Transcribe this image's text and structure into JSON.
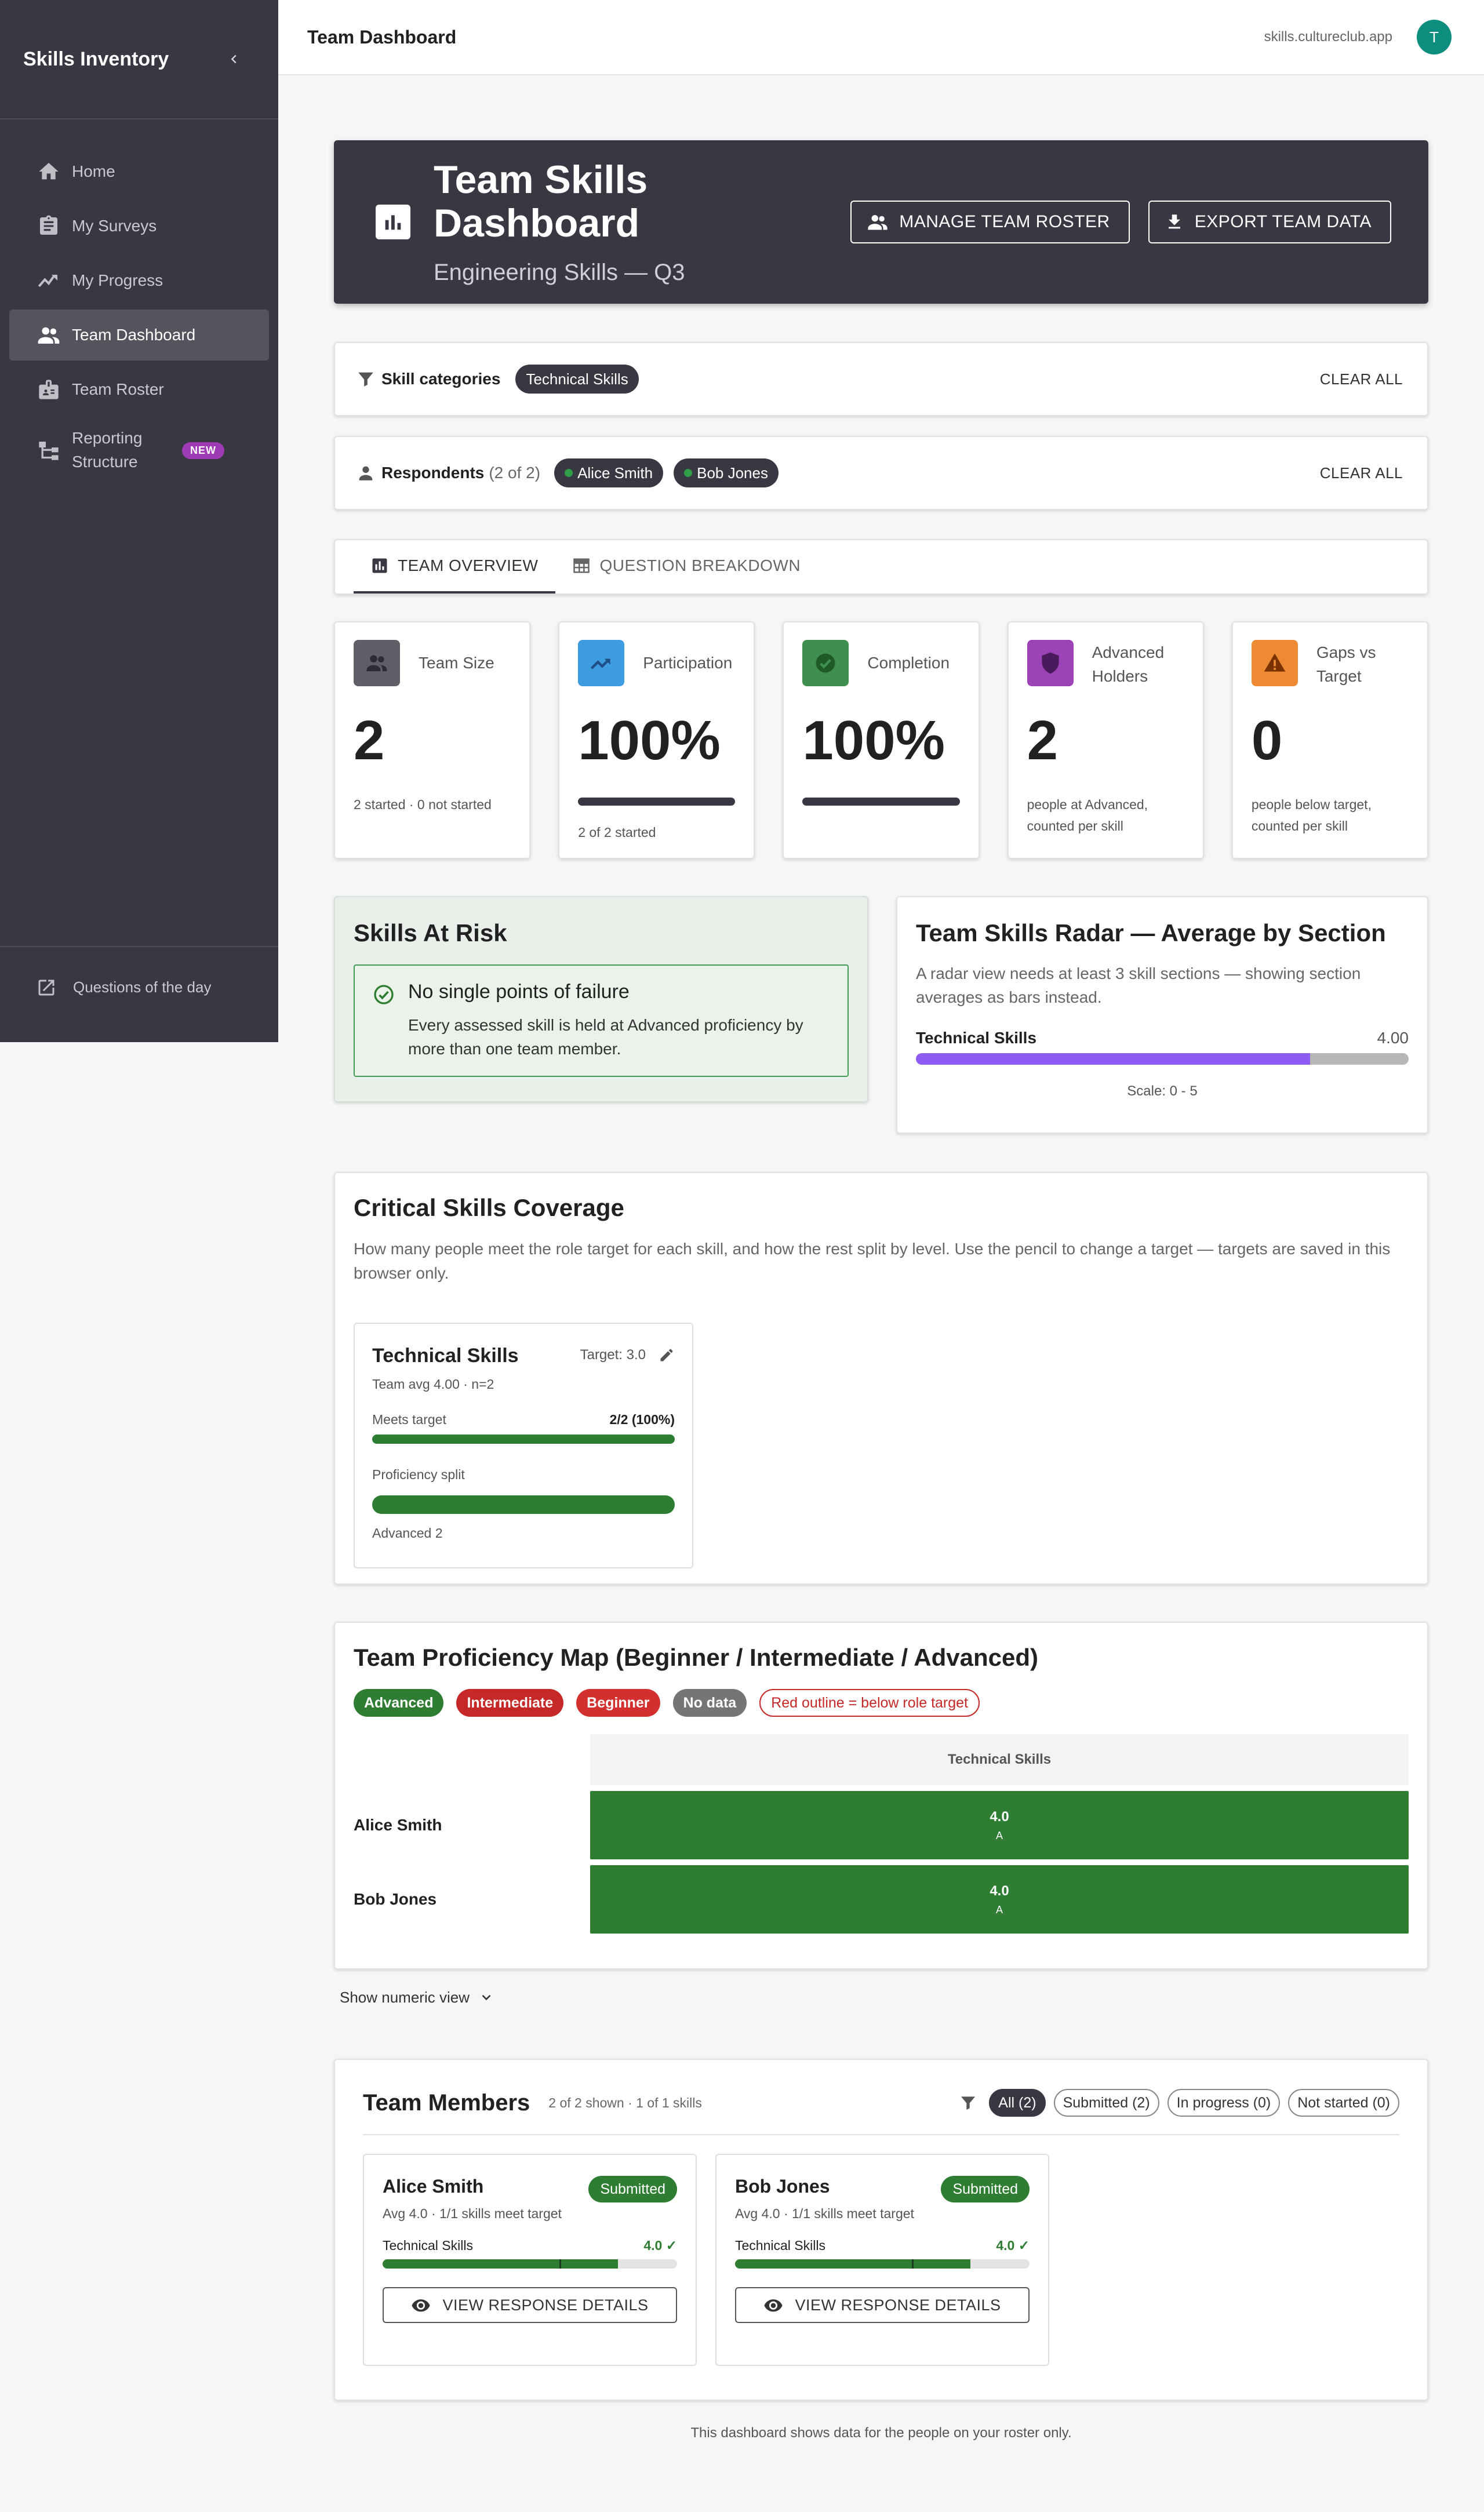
{
  "sidebar": {
    "title": "Skills Inventory",
    "items": [
      {
        "label": "Home",
        "icon": "home-icon"
      },
      {
        "label": "My Surveys",
        "icon": "clipboard-icon"
      },
      {
        "label": "My Progress",
        "icon": "trend-icon"
      },
      {
        "label": "Team Dashboard",
        "icon": "people-icon",
        "active": true
      },
      {
        "label": "Team Roster",
        "icon": "badge-icon"
      },
      {
        "label": "Reporting Structure",
        "icon": "org-chart-icon",
        "badge": "NEW"
      }
    ],
    "footer_label": "Questions of the day"
  },
  "topbar": {
    "title": "Team Dashboard",
    "domain": "skills.cultureclub.app",
    "avatar_initial": "T"
  },
  "hero": {
    "title": "Team Skills Dashboard",
    "subtitle": "Engineering Skills — Q3",
    "manage_btn": "MANAGE TEAM ROSTER",
    "export_btn": "EXPORT TEAM DATA"
  },
  "filters": {
    "categories": {
      "label": "Skill categories",
      "chips": [
        "Technical Skills"
      ],
      "clear": "CLEAR ALL"
    },
    "respondents": {
      "label": "Respondents",
      "count": "(2 of 2)",
      "chips": [
        "Alice Smith",
        "Bob Jones"
      ],
      "clear": "CLEAR ALL"
    }
  },
  "tabs": [
    {
      "label": "TEAM OVERVIEW",
      "active": true
    },
    {
      "label": "QUESTION BREAKDOWN",
      "active": false
    }
  ],
  "kpis": [
    {
      "label": "Team Size",
      "value": "2",
      "note": "2 started · 0 not started",
      "icon": "people-icon",
      "color": "#5f5f68"
    },
    {
      "label": "Participation",
      "value": "100%",
      "note": "2 of 2 started",
      "icon": "trend-icon",
      "color": "#3e9de0",
      "progress": 1.0
    },
    {
      "label": "Completion",
      "value": "100%",
      "note": "",
      "icon": "check-circle-icon",
      "color": "#3f8f4e",
      "progress": 1.0
    },
    {
      "label": "Advanced Holders",
      "value": "2",
      "note": "people at Advanced, counted per skill",
      "icon": "shield-icon",
      "color": "#9b44b8"
    },
    {
      "label": "Gaps vs Target",
      "value": "0",
      "note": "people below target, counted per skill",
      "icon": "warning-icon",
      "color": "#ee8a34"
    }
  ],
  "risk": {
    "title": "Skills At Risk",
    "heading": "No single points of failure",
    "text": "Every assessed skill is held at Advanced proficiency by more than one team member."
  },
  "radar": {
    "title": "Team Skills Radar — Average by Section",
    "desc": "A radar view needs at least 3 skill sections — showing section averages as bars instead.",
    "skill": "Technical Skills",
    "value": "4.00",
    "fraction": 0.8,
    "scale": "Scale: 0 - 5",
    "color": "#8d5cf2"
  },
  "coverage": {
    "title": "Critical Skills Coverage",
    "desc": "How many people meet the role target for each skill, and how the rest split by level. Use the pencil to change a target — targets are saved in this browser only.",
    "card": {
      "name": "Technical Skills",
      "target": "Target: 3.0",
      "sub": "Team avg 4.00 · n=2",
      "meets_label": "Meets target",
      "meets_value": "2/2 (100%)",
      "meets_fraction": 1.0,
      "split_label": "Proficiency split",
      "advanced_label": "Advanced 2"
    }
  },
  "pmap": {
    "title": "Team Proficiency Map (Beginner / Intermediate / Advanced)",
    "legend": [
      {
        "label": "Advanced",
        "color": "#2e7d32"
      },
      {
        "label": "Intermediate",
        "color": "#c62828"
      },
      {
        "label": "Beginner",
        "color": "#d32f2f"
      },
      {
        "label": "No data",
        "color": "#757575"
      },
      {
        "label": "Red outline = below role target",
        "color": "#c62828",
        "outline": true
      }
    ],
    "column": "Technical Skills",
    "rows": [
      {
        "name": "Alice Smith",
        "value": "4.0",
        "level": "A"
      },
      {
        "name": "Bob Jones",
        "value": "4.0",
        "level": "A"
      }
    ],
    "toggle": "Show numeric view"
  },
  "members": {
    "title": "Team Members",
    "count": "2 of 2 shown · 1 of 1 skills",
    "filters": [
      {
        "label": "All (2)",
        "active": true
      },
      {
        "label": "Submitted (2)",
        "active": false
      },
      {
        "label": "In progress (0)",
        "active": false
      },
      {
        "label": "Not started (0)",
        "active": false
      }
    ],
    "cards": [
      {
        "name": "Alice Smith",
        "badge": "Submitted",
        "sub": "Avg 4.0 · 1/1 skills meet target",
        "skill": "Technical Skills",
        "score": "4.0 ✓",
        "fraction": 0.8,
        "target_fraction": 0.6,
        "button": "VIEW RESPONSE DETAILS"
      },
      {
        "name": "Bob Jones",
        "badge": "Submitted",
        "sub": "Avg 4.0 · 1/1 skills meet target",
        "skill": "Technical Skills",
        "score": "4.0 ✓",
        "fraction": 0.8,
        "target_fraction": 0.6,
        "button": "VIEW RESPONSE DETAILS"
      }
    ]
  },
  "footer": "This dashboard shows data for the people on your roster only."
}
